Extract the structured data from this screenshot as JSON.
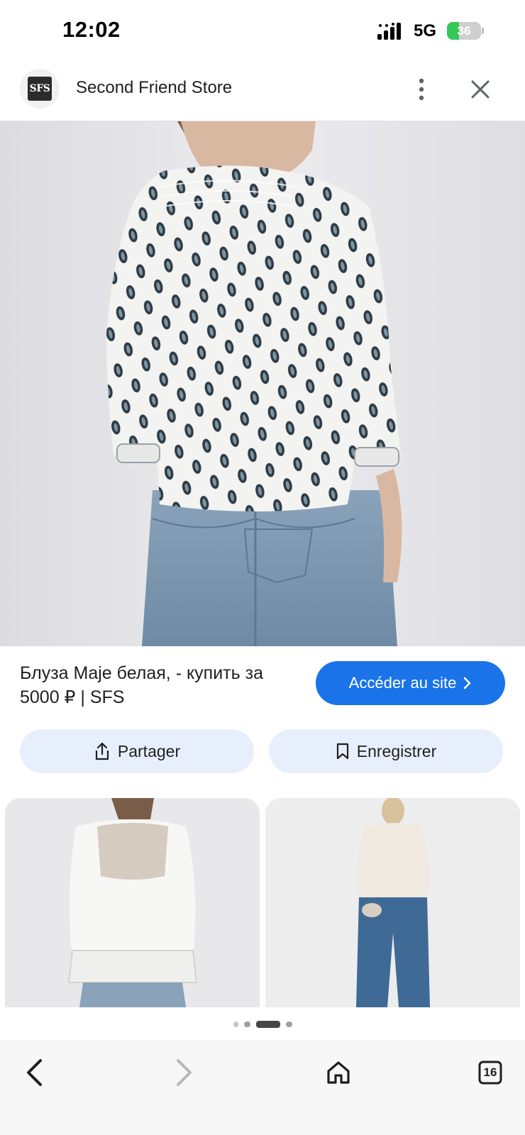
{
  "status_bar": {
    "time": "12:02",
    "network": "5G",
    "battery": "36",
    "battery_level": 0.36
  },
  "header": {
    "logo_text": "SFS",
    "store_name": "Second Friend Store"
  },
  "result": {
    "title": "Блуза Maje белая, - купить за 5000 ₽ | SFS",
    "visit_label": "Accéder au site"
  },
  "actions": {
    "share_label": "Partager",
    "save_label": "Enregistrer"
  },
  "pager": {
    "count": 4,
    "active": 2
  },
  "bottom_nav": {
    "tabs_count": "16"
  },
  "colors": {
    "accent": "#1a73e8",
    "action_bg": "#e8effc",
    "battery_green": "#36c759"
  },
  "icons": [
    "signal-icon",
    "battery-icon",
    "more-vert-icon",
    "close-icon",
    "chevron-right-icon",
    "share-icon",
    "bookmark-icon",
    "back-arrow-icon",
    "forward-arrow-icon",
    "home-icon",
    "tabs-icon"
  ]
}
